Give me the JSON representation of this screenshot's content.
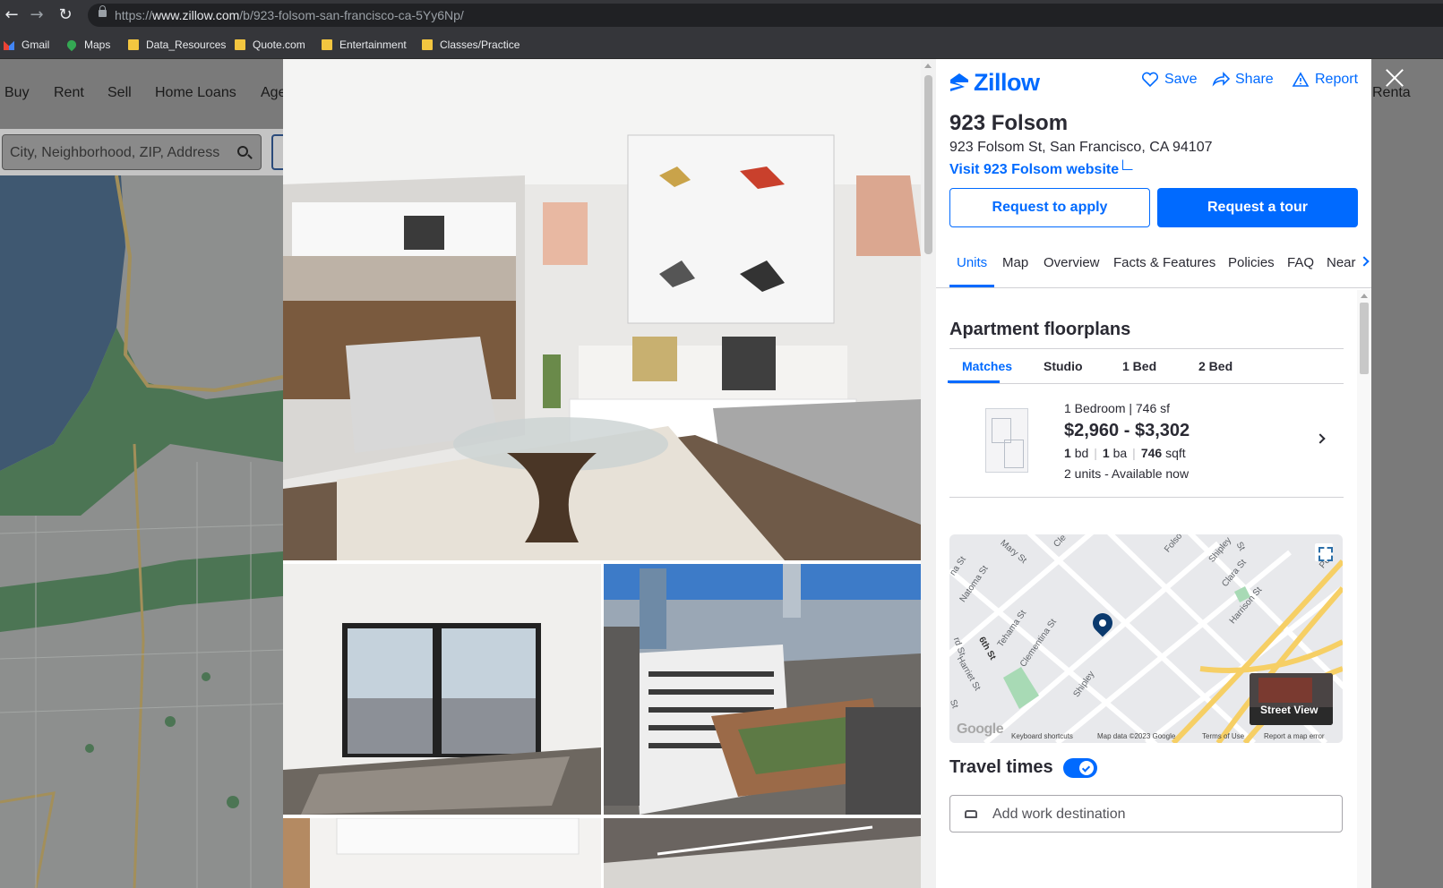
{
  "browser": {
    "url_prefix": "https://",
    "url_host": "www.zillow.com",
    "url_path": "/b/923-folsom-san-francisco-ca-5Yy6Np/",
    "bookmarks": [
      {
        "label": "Gmail",
        "icon": "gmail-icon"
      },
      {
        "label": "Maps",
        "icon": "maps-icon"
      },
      {
        "label": "Data_Resources",
        "icon": "folder-icon"
      },
      {
        "label": "Quote.com",
        "icon": "folder-icon"
      },
      {
        "label": "Entertainment",
        "icon": "folder-icon"
      },
      {
        "label": "Classes/Practice",
        "icon": "folder-icon"
      }
    ]
  },
  "background_page": {
    "nav": [
      "Buy",
      "Rent",
      "Sell",
      "Home Loans",
      "Age"
    ],
    "right_nav": "Renta",
    "search_placeholder": "City, Neighborhood, ZIP, Address"
  },
  "panel": {
    "brand": "Zillow",
    "actions": {
      "save": "Save",
      "share": "Share",
      "report": "Report"
    },
    "title": "923 Folsom",
    "address": "923 Folsom St, San Francisco, CA 94107",
    "website_link": "Visit 923 Folsom website",
    "request_apply": "Request to apply",
    "request_tour": "Request a tour",
    "tabs": [
      "Units",
      "Map",
      "Overview",
      "Facts & Features",
      "Policies",
      "FAQ",
      "Near"
    ],
    "floorplans": {
      "title": "Apartment floorplans",
      "filters": [
        "Matches",
        "Studio",
        "1 Bed",
        "2 Bed"
      ],
      "unit": {
        "subtitle": "1 Bedroom | 746 sf",
        "price": "$2,960 - $3,302",
        "beds": "1",
        "beds_unit": "bd",
        "baths": "1",
        "baths_unit": "ba",
        "sqft": "746",
        "sqft_unit": "sqft",
        "availability": "2 units - Available now"
      }
    },
    "map": {
      "streets": [
        "Natoma St",
        "Mary St",
        "Cle",
        "Folso",
        "Shipley",
        "St",
        "Clara St",
        "Harrison St",
        "Perr",
        "Tehama St",
        "Clementina St",
        "6th St",
        "Harriet St",
        "rd St",
        "Shipley",
        "na St",
        "St"
      ],
      "street_view": "Street View",
      "google": "Google",
      "footer": [
        "Keyboard shortcuts",
        "Map data ©2023 Google",
        "Terms of Use",
        "Report a map error"
      ]
    },
    "travel": {
      "title": "Travel times",
      "enabled": true,
      "placeholder": "Add work destination"
    }
  },
  "colors": {
    "brand_blue": "#006aff",
    "text_dark": "#2a2a33"
  }
}
